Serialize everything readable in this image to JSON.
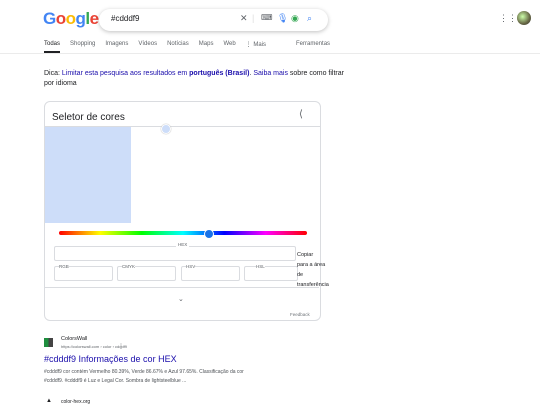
{
  "header": {
    "logo_letters": [
      "G",
      "o",
      "o",
      "g",
      "l",
      "e"
    ],
    "query": "#cdddf9",
    "icons": [
      "close-icon",
      "keyboard-icon",
      "mic-icon",
      "lens-icon",
      "search-icon"
    ],
    "apps_icon": "grid-icon"
  },
  "tabs": [
    "Todas",
    "Shopping",
    "Imagens",
    "Vídeos",
    "Notícias",
    "Maps",
    "Web",
    "⋮ Mais",
    "Ferramentas"
  ],
  "hint": {
    "prefix": "Dica: ",
    "link1": "Limitar esta pesquisa aos resultados em ",
    "bold": "português (Brasil)",
    "dot": ". ",
    "link2": "Saiba mais",
    "suffix": " sobre como filtrar por idioma"
  },
  "picker": {
    "title": "Seletor de cores",
    "color": "#cdddf9",
    "hue_position": 0.6,
    "hex_label": "HEX",
    "fields": [
      "RGB",
      "CMYK",
      "HSV",
      "HSL"
    ],
    "copy_text": [
      "Copiar",
      "para a área",
      "de",
      "transferência"
    ],
    "feedback": "Feedback"
  },
  "result1": {
    "site": "ColorsWall",
    "url": "https://colorswall.com › color › cdddf9",
    "title": "#cdddf9 Informações de cor HEX",
    "snippet_line1": "#cdddf9 cor contém Vermelho 80.39%, Verde 86.67% e Azul 97.65%. Classificação da cor",
    "snippet_line2": "#cdddf9. #cdddf9 é Luz e Legal Cor. Sombra de lightsteelblue ..."
  },
  "result2": {
    "site": "color-hex.org"
  }
}
